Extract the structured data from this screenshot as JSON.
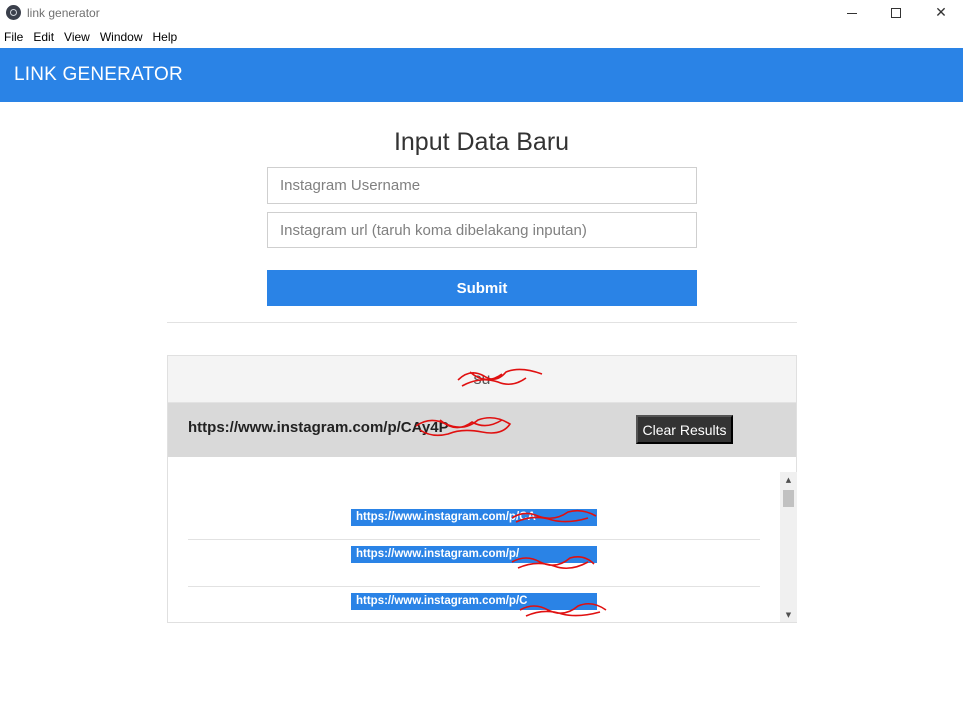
{
  "window": {
    "title": "link generator",
    "minimize_icon": "minimize-icon",
    "maximize_icon": "maximize-icon",
    "close_icon": "close-icon",
    "close_glyph": "✕"
  },
  "menu": {
    "items": [
      "File",
      "Edit",
      "View",
      "Window",
      "Help"
    ]
  },
  "header": {
    "title": "LINK GENERATOR",
    "color": "#2a83e6"
  },
  "form": {
    "title": "Input Data Baru",
    "username_placeholder": "Instagram Username",
    "url_placeholder": "Instagram url (taruh koma dibelakang inputan)",
    "submit_label": "Submit"
  },
  "results": {
    "status_text": "su",
    "current_link": "https://www.instagram.com/p/CAy4P",
    "clear_label": "Clear Results",
    "links": [
      "https://www.instagram.com/p/CA",
      "https://www.instagram.com/p/",
      "https://www.instagram.com/p/C"
    ],
    "scroll_up_glyph": "▲",
    "scroll_down_glyph": "▼"
  },
  "colors": {
    "accent": "#2a83e6",
    "dark_button": "#333333",
    "redaction": "#e01010"
  }
}
